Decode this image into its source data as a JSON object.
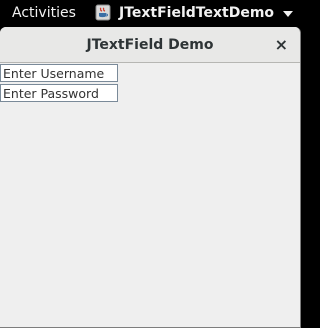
{
  "topbar": {
    "activities_label": "Activities",
    "app_name": "JTextFieldTextDemo",
    "app_icon": "java-icon"
  },
  "window": {
    "title": "JTextField Demo",
    "close_glyph": "×"
  },
  "fields": {
    "username_value": "Enter Username",
    "password_value": "Enter Password"
  }
}
